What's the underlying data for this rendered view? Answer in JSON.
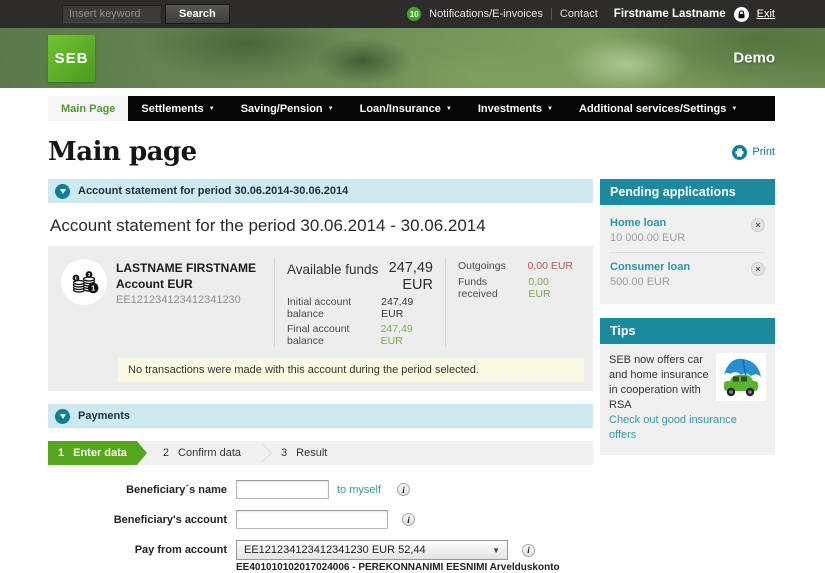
{
  "topbar": {
    "search_placeholder": "Insert keyword",
    "search_button": "Search",
    "notification_count": "10",
    "notifications_label": "Notifications/E-invoices",
    "contact_label": "Contact",
    "user_name": "Firstname Lastname",
    "exit_label": "Exit"
  },
  "header": {
    "logo": "SEB",
    "mode_label": "Demo"
  },
  "nav": {
    "items": [
      {
        "label": "Main Page"
      },
      {
        "label": "Settlements"
      },
      {
        "label": "Saving/Pension"
      },
      {
        "label": "Loan/Insurance"
      },
      {
        "label": "Investments"
      },
      {
        "label": "Additional services/Settings"
      }
    ]
  },
  "page": {
    "title": "Main page",
    "print_label": "Print"
  },
  "statement": {
    "section_title": "Account statement for period 30.06.2014-30.06.2014",
    "heading": "Account statement for the period 30.06.2014 - 30.06.2014",
    "account_name": "LASTNAME FIRSTNAME",
    "account_type": "Account EUR",
    "account_number": "EE121234123412341230",
    "available_funds_label": "Available funds",
    "available_funds_amount": "247,49",
    "available_funds_currency": "EUR",
    "initial_balance_label": "Initial account balance",
    "initial_balance_value": "247,49 EUR",
    "final_balance_label": "Final account balance",
    "final_balance_value": "247,49 EUR",
    "outgoings_label": "Outgoings",
    "outgoings_value": "0,00 EUR",
    "funds_received_label": "Funds received",
    "funds_received_value": "0,00 EUR",
    "no_transactions_note": "No transactions were made with this account during the period selected."
  },
  "payments": {
    "section_title": "Payments",
    "steps": [
      {
        "num": "1",
        "label": "Enter data"
      },
      {
        "num": "2",
        "label": "Confirm data"
      },
      {
        "num": "3",
        "label": "Result"
      }
    ],
    "beneficiary_name_label": "Beneficiary´s name",
    "to_myself_label": "to myself",
    "beneficiary_account_label": "Beneficiary's account",
    "pay_from_label": "Pay from account",
    "pay_from_value": "EE121234123412341230 EUR 52,44",
    "pay_from_detail": "EE401010102017024006 - PEREKONNANIMI EESNIMI Arvelduskonto"
  },
  "sidebar": {
    "pending": {
      "title": "Pending applications",
      "items": [
        {
          "name": "Home loan",
          "amount": "10 000.00 EUR"
        },
        {
          "name": "Consumer loan",
          "amount": "500.00 EUR"
        }
      ]
    },
    "tips": {
      "title": "Tips",
      "text": "SEB now offers car and home insurance in cooperation with RSA",
      "link": "Check out good insurance offers"
    }
  },
  "icons": {
    "dropdown_arrow": "▼",
    "select_arrow": "▼",
    "close": "×",
    "info": "i"
  },
  "colors": {
    "brand_green": "#5db32d",
    "accent_teal": "#1b8a9f",
    "light_blue_bar": "#cfe9f1",
    "step_green": "#55a51f",
    "negative_red": "#c0564f",
    "positive_green": "#7ea951"
  }
}
